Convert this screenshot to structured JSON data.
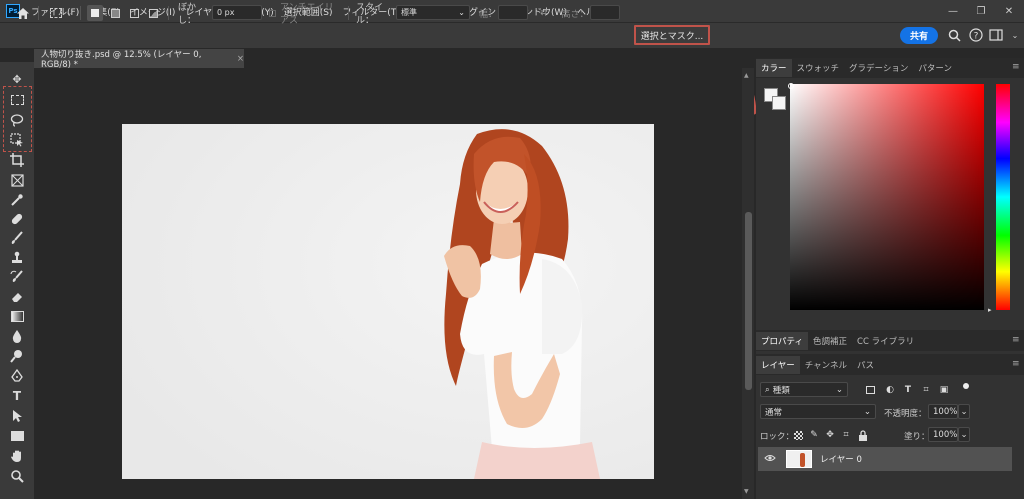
{
  "app": {
    "logo": "Ps"
  },
  "menu": [
    "ファイル(F)",
    "編集(E)",
    "イメージ(I)",
    "レイヤー(L)",
    "書式(Y)",
    "選択範囲(S)",
    "フィルター(T)",
    "表示(V)",
    "プラグイン",
    "ウィンドウ(W)",
    "ヘルプ(H)"
  ],
  "window_controls": {
    "minimize": "—",
    "maximize": "❐",
    "close": "✕"
  },
  "options": {
    "blur_label": "ぼかし：",
    "blur_value": "0 px",
    "antialias_label": "アンチエイリアス",
    "style_label": "スタイル：",
    "style_value": "標準",
    "width_label": "幅：",
    "height_label": "高さ：",
    "select_mask_button": "選択とマスク...",
    "share_button": "共有"
  },
  "document_tab": {
    "title": "人物切り抜き.psd @ 12.5% (レイヤー 0, RGB/8) *",
    "close": "×"
  },
  "color_panel": {
    "tabs": [
      "カラー",
      "スウォッチ",
      "グラデーション",
      "パターン"
    ]
  },
  "properties_panel": {
    "tabs": [
      "プロパティ",
      "色調補正",
      "CC ライブラリ"
    ]
  },
  "layers_panel": {
    "tabs": [
      "レイヤー",
      "チャンネル",
      "パス"
    ],
    "filter_value": "種類",
    "blend_mode": "通常",
    "opacity_label": "不透明度：",
    "opacity_value": "100%",
    "lock_label": "ロック：",
    "fill_label": "塗り：",
    "fill_value": "100%",
    "layers": [
      {
        "name": "レイヤー 0",
        "visible": true
      }
    ]
  },
  "colors": {
    "accent": "#c0534a",
    "share": "#1473e6"
  }
}
